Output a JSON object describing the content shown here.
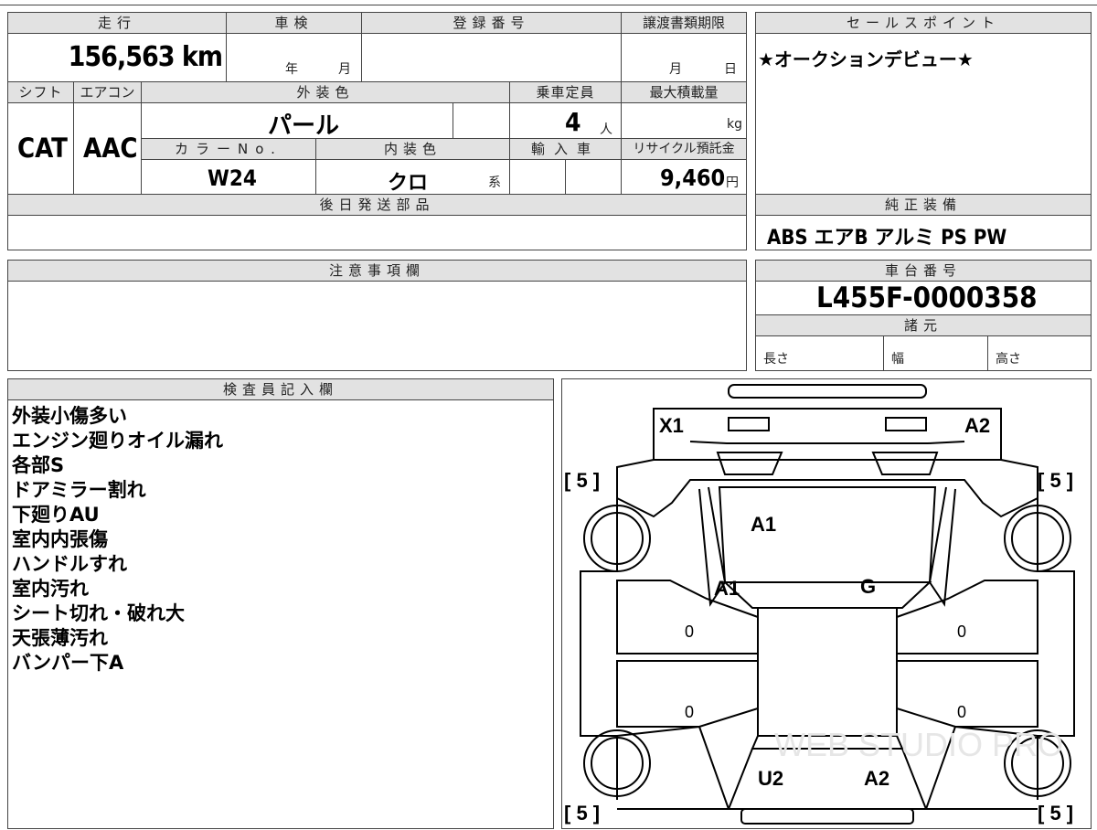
{
  "headers": {
    "mileage": "走行",
    "inspection": "車検",
    "registration": "登録番号",
    "transfer_deadline": "譲渡書類期限",
    "sales_point": "セールスポイント",
    "shift": "シフト",
    "aircon": "エアコン",
    "exterior_color": "外装色",
    "capacity": "乗車定員",
    "max_load": "最大積載量",
    "color_no": "カラーNo.",
    "interior_color": "内装色",
    "imported": "輸入車",
    "recycle_fee": "リサイクル預託金",
    "later_parts": "後日発送部品",
    "standard_equipment": "純正装備",
    "notes": "注意事項欄",
    "chassis_no": "車台番号",
    "specs": "諸元",
    "inspector": "検査員記入欄"
  },
  "values": {
    "mileage": "156,563 km",
    "inspection_year": "年",
    "inspection_month": "月",
    "transfer_month": "月",
    "transfer_day": "日",
    "shift": "CAT",
    "aircon": "AAC",
    "exterior_color": "パール",
    "capacity": "4",
    "capacity_unit": "人",
    "max_load_unit": "kg",
    "color_no": "W24",
    "interior_color": "クロ",
    "interior_suffix": "系",
    "recycle_fee": "9,460",
    "recycle_unit": "円",
    "sales_point": "★オークションデビュー★",
    "standard_equipment": "ABS エアB アルミ PS PW",
    "chassis_no": "L455F-0000358",
    "spec_length": "長さ",
    "spec_width": "幅",
    "spec_height": "高さ"
  },
  "inspector_remarks": [
    "外装小傷多い",
    "エンジン廻りオイル漏れ",
    "各部S",
    "ドアミラー割れ",
    "下廻りAU",
    "室内内張傷",
    "ハンドルすれ",
    "室内汚れ",
    "シート切れ・破れ大",
    "天張薄汚れ",
    "バンパー下A"
  ],
  "diagram": {
    "marks": {
      "front_left": "X1",
      "front_right": "A2",
      "hood": "A1",
      "left_pillar": "A1",
      "windshield": "G",
      "rear_left": "U2",
      "rear_right": "A2",
      "left_door_front": "0",
      "left_door_rear": "0",
      "right_door_front": "0",
      "right_door_rear": "0"
    },
    "tires": {
      "front_left": "[ 5 ]",
      "front_right": "[ 5 ]",
      "rear_left": "[ 5 ]",
      "rear_right": "[ 5 ]"
    },
    "watermark": "WEB STUDIO PRO"
  }
}
